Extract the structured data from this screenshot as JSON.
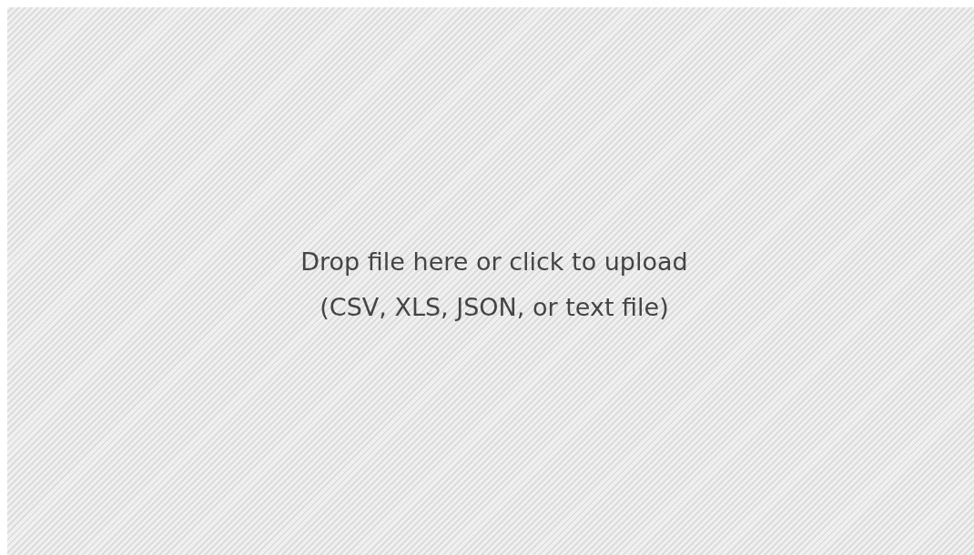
{
  "dropzone": {
    "prompt": "Drop file here or click to upload",
    "hint": "(CSV, XLS, JSON, or text file)"
  }
}
